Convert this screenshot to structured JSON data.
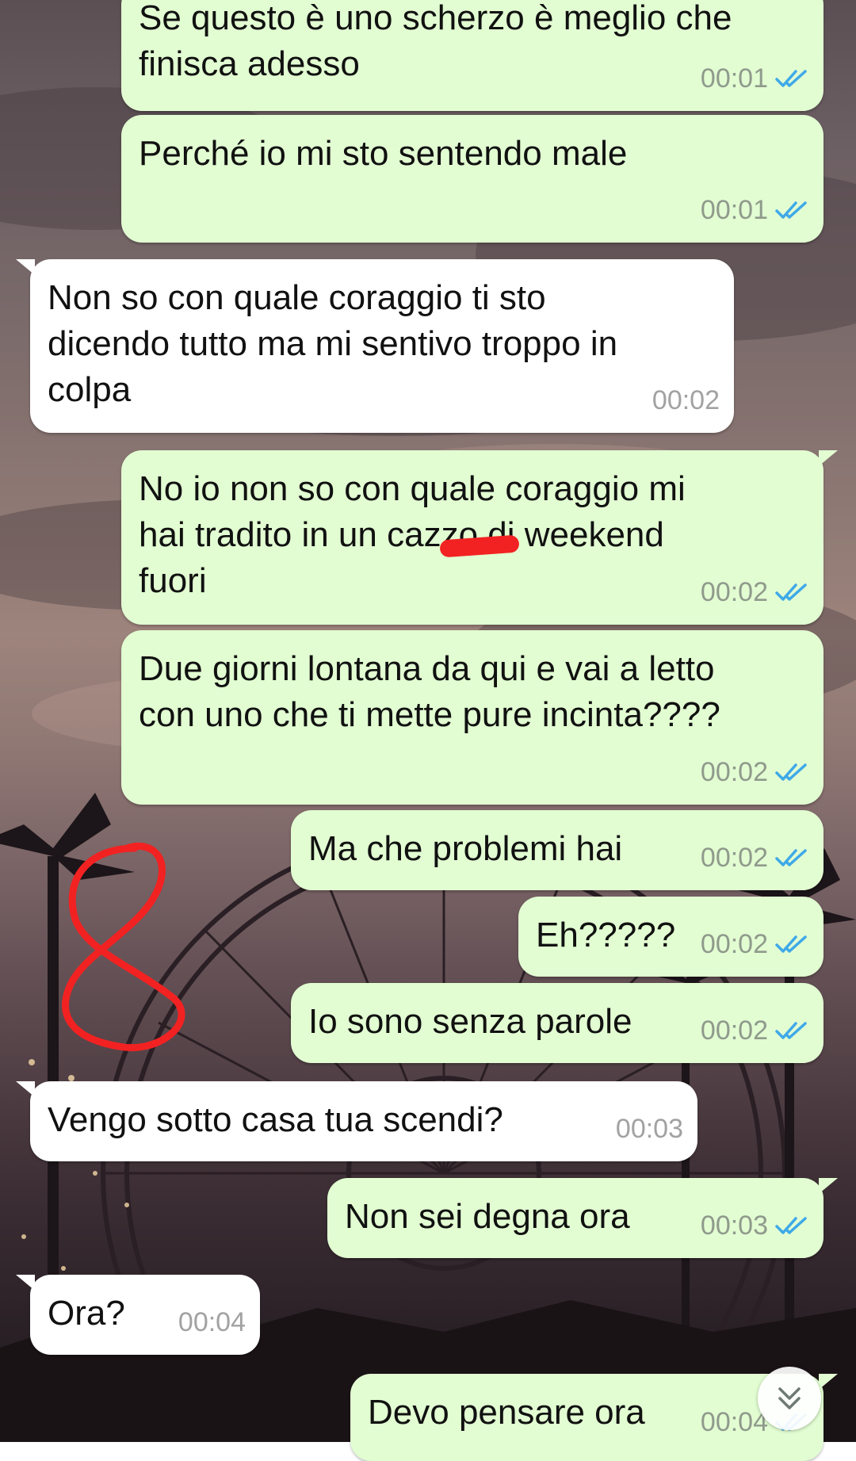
{
  "chat": {
    "messages": [
      {
        "dir": "out",
        "text": "Se questo è uno scherzo è meglio che\nfinisca adesso",
        "time": "00:01",
        "status": "read"
      },
      {
        "dir": "out",
        "text": "Perché io mi sto sentendo male",
        "time": "00:01",
        "status": "read"
      },
      {
        "dir": "in",
        "text": "Non so con quale coraggio ti sto\ndicendo tutto ma mi sentivo troppo in\ncolpa",
        "time": "00:02"
      },
      {
        "dir": "out",
        "text": "No io non so con quale coraggio mi\nhai tradito in un cazzo di weekend\nfuori",
        "time": "00:02",
        "status": "read"
      },
      {
        "dir": "out",
        "text": "Due giorni lontana da qui e vai a letto\ncon uno che ti mette pure incinta????",
        "time": "00:02",
        "status": "read"
      },
      {
        "dir": "out",
        "text": "Ma che problemi hai",
        "time": "00:02",
        "status": "read"
      },
      {
        "dir": "out",
        "text": "Eh?????",
        "time": "00:02",
        "status": "read"
      },
      {
        "dir": "out",
        "text": "Io sono senza parole",
        "time": "00:02",
        "status": "read"
      },
      {
        "dir": "in",
        "text": "Vengo sotto casa tua scendi?",
        "time": "00:03"
      },
      {
        "dir": "out",
        "text": "Non sei degna ora",
        "time": "00:03",
        "status": "read"
      },
      {
        "dir": "in",
        "text": "Ora?",
        "time": "00:04"
      },
      {
        "dir": "out",
        "text": "Devo pensare ora",
        "time": "00:04",
        "status": "read"
      }
    ]
  },
  "colors": {
    "outgoing_bubble": "#e2fdd2",
    "incoming_bubble": "#ffffff",
    "read_ticks": "#3fa9e8",
    "annotation": "#f22222"
  },
  "icons": {
    "read_receipt": "double-check-icon",
    "scroll_down": "double-chevron-down-icon"
  }
}
